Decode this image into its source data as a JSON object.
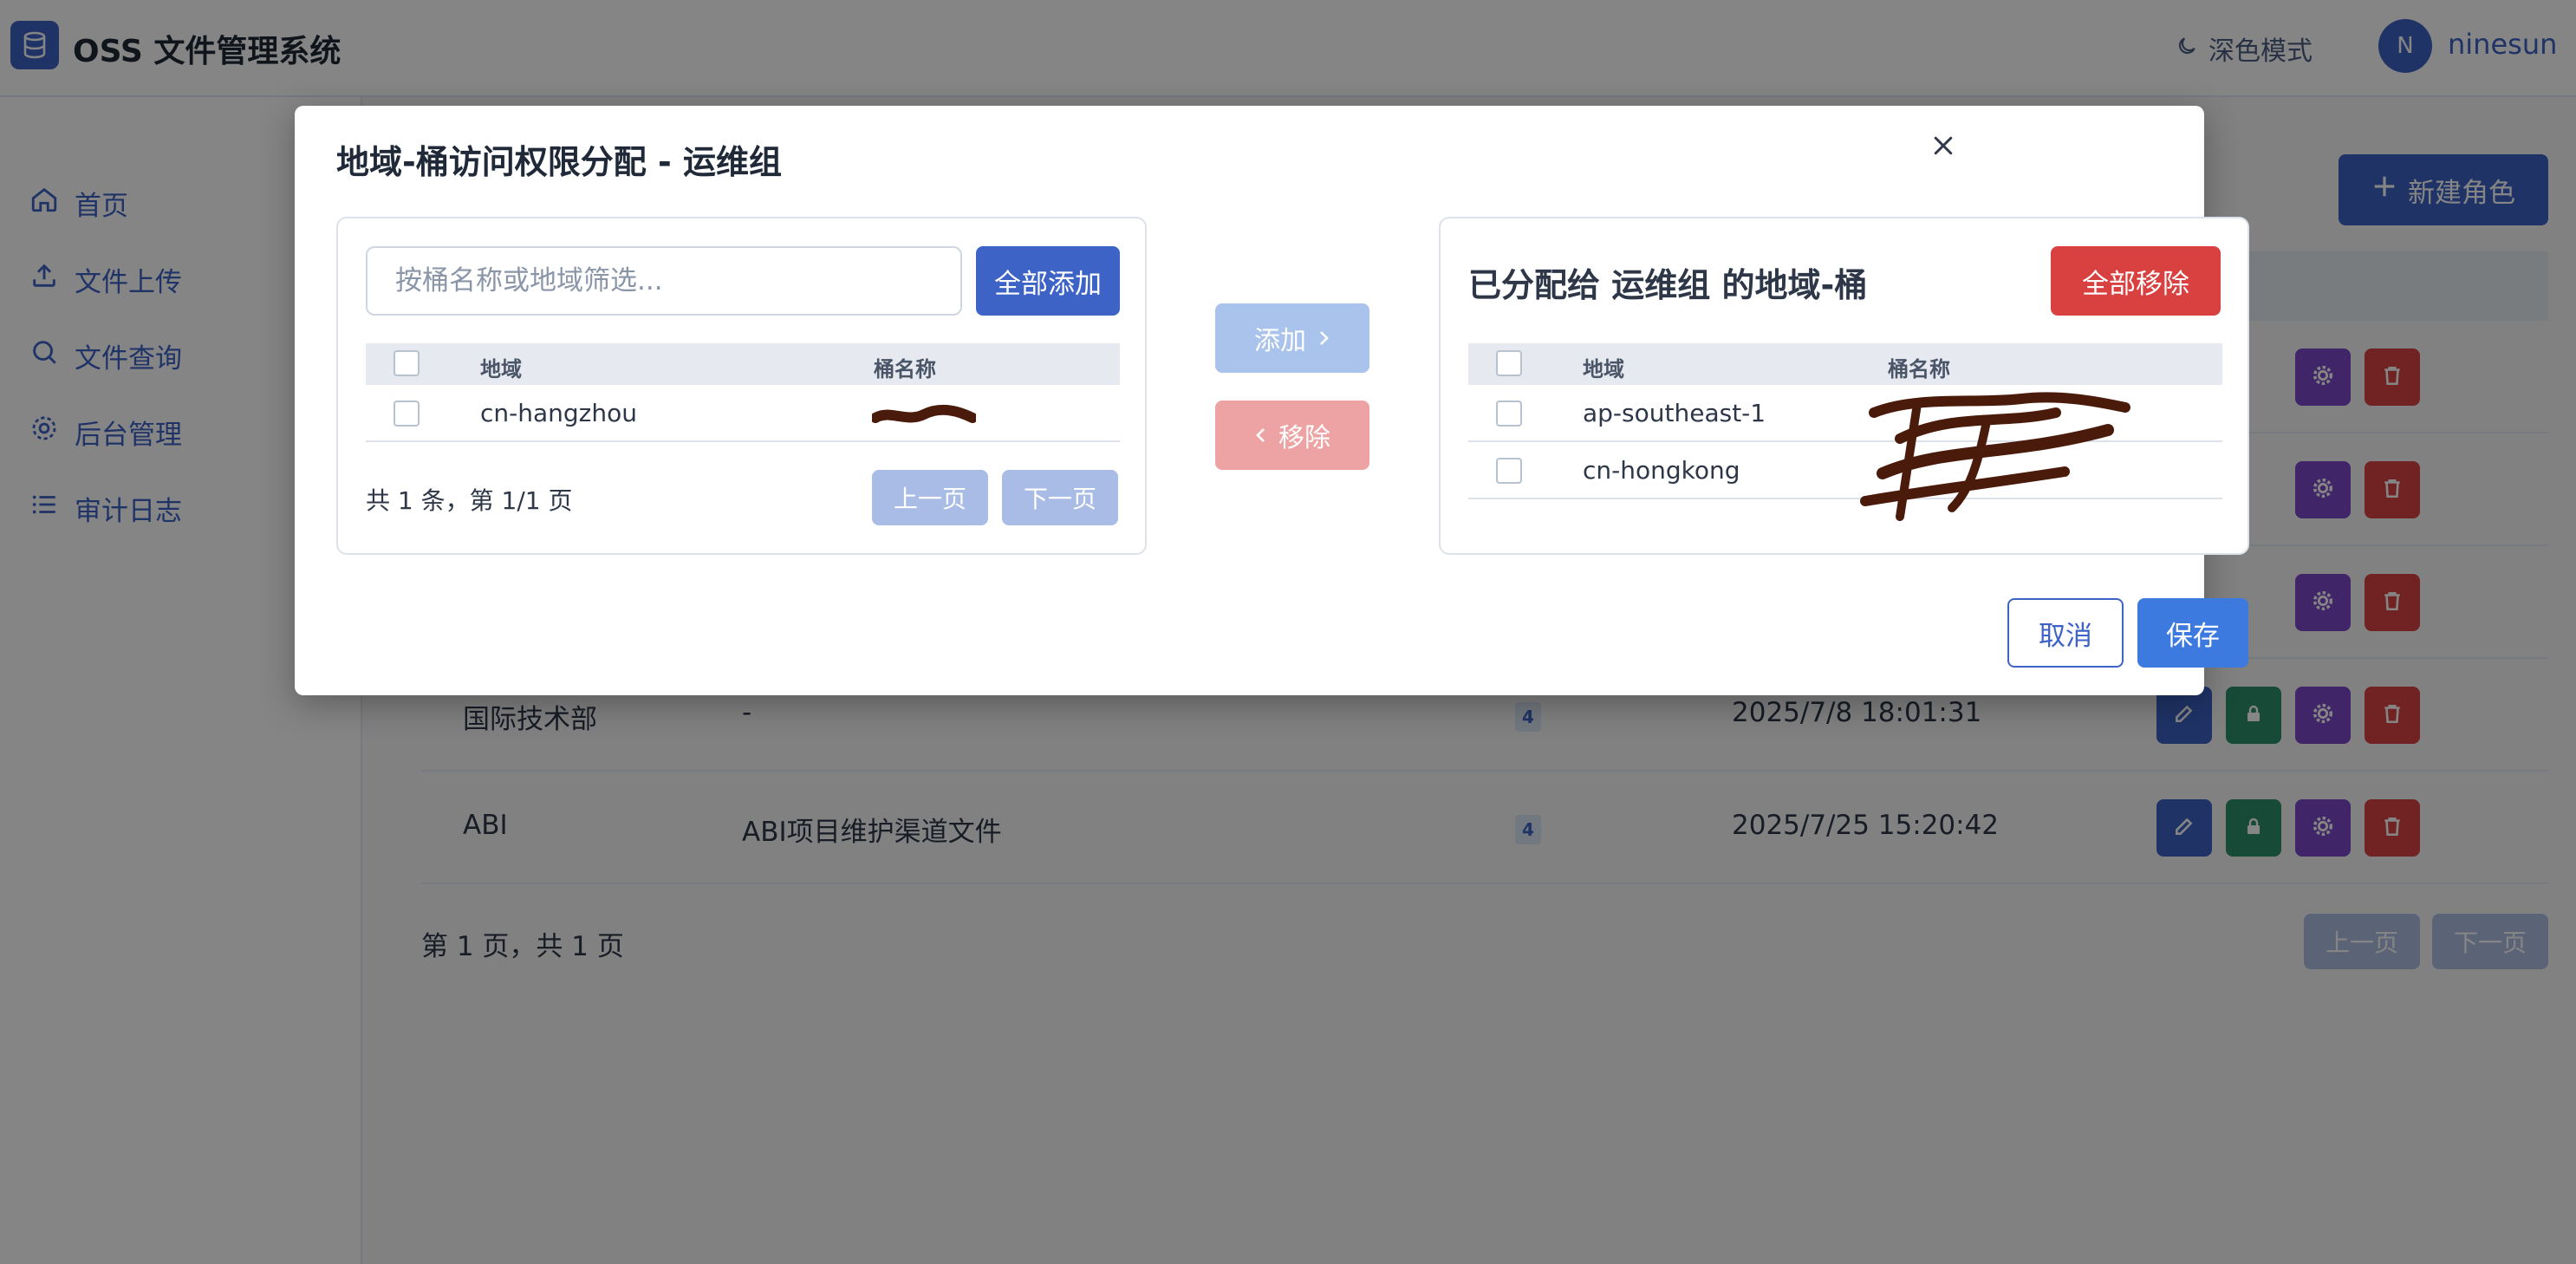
{
  "app": {
    "title": "OSS 文件管理系统",
    "dark_mode_label": "深色模式"
  },
  "user": {
    "initial": "N",
    "name": "ninesun"
  },
  "sidebar": {
    "items": [
      {
        "label": "首页",
        "icon": "home-icon"
      },
      {
        "label": "文件上传",
        "icon": "upload-icon"
      },
      {
        "label": "文件查询",
        "icon": "search-icon"
      },
      {
        "label": "后台管理",
        "icon": "gear-icon"
      },
      {
        "label": "审计日志",
        "icon": "list-icon"
      }
    ]
  },
  "main": {
    "new_role_label": "新建角色",
    "rows": [
      {
        "name": "国际技术部",
        "description": "-",
        "count": "4",
        "created": "2025/7/8 18:01:31"
      },
      {
        "name": "ABI",
        "description": "ABI项目维护渠道文件",
        "count": "4",
        "created": "2025/7/25 15:20:42"
      }
    ],
    "pagination": {
      "info": "第 1 页，共 1 页",
      "prev": "上一页",
      "next": "下一页"
    }
  },
  "modal": {
    "title": "地域-桶访问权限分配 - 运维组",
    "left": {
      "filter_placeholder": "按桶名称或地域筛选...",
      "add_all_label": "全部添加",
      "columns": [
        "地域",
        "桶名称"
      ],
      "rows": [
        {
          "region": "cn-hangzhou"
        }
      ],
      "footer_info": "共 1 条，第 1/1 页",
      "prev": "上一页",
      "next": "下一页"
    },
    "middle": {
      "add_label": "添加",
      "remove_label": "移除"
    },
    "right": {
      "title": "已分配给 运维组 的地域-桶",
      "remove_all_label": "全部移除",
      "columns": [
        "地域",
        "桶名称"
      ],
      "rows": [
        {
          "region": "ap-southeast-1"
        },
        {
          "region": "cn-hongkong"
        }
      ]
    },
    "cancel_label": "取消",
    "save_label": "保存"
  },
  "colors": {
    "primary": "#3d63c6",
    "danger": "#d94141",
    "success": "#2f8f6b",
    "purple": "#7c47c9"
  }
}
